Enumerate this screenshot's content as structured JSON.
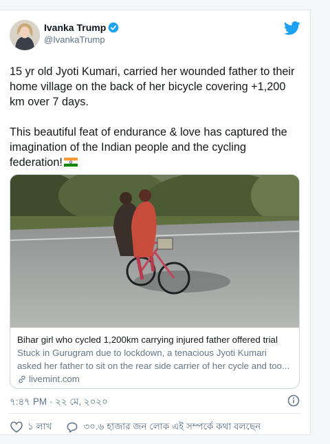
{
  "tweet": {
    "author": {
      "display_name": "Ivanka Trump",
      "handle": "@IvankaTrump",
      "verified": true
    },
    "paragraphs": [
      "15 yr old Jyoti Kumari, carried her wounded father to their home village on the back of her bicycle covering +1,200 km over 7 days.",
      "This beautiful feat of endurance & love has captured the imagination of the Indian people and the cycling federation!"
    ],
    "timestamp": "৭:৪৭ PM · ২২ মে, ২০২০",
    "likes": "১ লাখ",
    "conversation": "৩০.৬ হাজার জন লোক এই সম্পর্কে কথা বলছেন"
  },
  "link_card": {
    "title": "Bihar girl who cycled 1,200km carrying injured father offered trial",
    "description": "Stuck in Gurugram due to lockdown, a tenacious Jyoti Kumari asked her father to sit on the rear side carrier of her cycle and too...",
    "domain": "livemint.com"
  },
  "icons": {
    "verified": "verified-badge-icon",
    "brand": "twitter-bird-icon",
    "flag": "india-flag-icon",
    "link": "link-icon",
    "info": "info-icon",
    "like": "heart-icon",
    "reply": "speech-bubble-icon"
  },
  "colors": {
    "twitter_blue": "#1da1f2",
    "secondary_text": "#5b7083",
    "border": "#e1e8ed"
  }
}
